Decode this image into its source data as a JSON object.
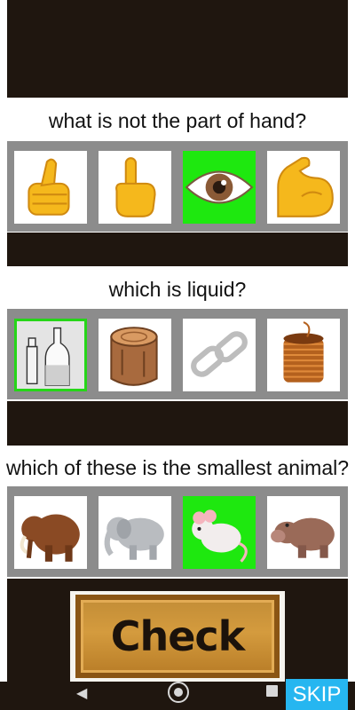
{
  "questions": [
    {
      "prompt": "what is not the part of hand?",
      "options": [
        {
          "name": "thumbs-up",
          "icon": "thumbs-up-icon",
          "selected": false
        },
        {
          "name": "pointing-finger",
          "icon": "pointing-finger-icon",
          "selected": false
        },
        {
          "name": "eye",
          "icon": "eye-icon",
          "selected": true
        },
        {
          "name": "flexed-biceps",
          "icon": "flexed-biceps-icon",
          "selected": false
        }
      ]
    },
    {
      "prompt": "which is liquid?",
      "options": [
        {
          "name": "bottles",
          "icon": "bottles-icon",
          "selected": true
        },
        {
          "name": "wood-log",
          "icon": "wood-log-icon",
          "selected": false
        },
        {
          "name": "chain",
          "icon": "chain-icon",
          "selected": false
        },
        {
          "name": "copper-wire",
          "icon": "copper-wire-icon",
          "selected": false
        }
      ]
    },
    {
      "prompt": "which of these is the smallest animal?",
      "options": [
        {
          "name": "mammoth",
          "icon": "mammoth-icon",
          "selected": false
        },
        {
          "name": "elephant",
          "icon": "elephant-icon",
          "selected": false
        },
        {
          "name": "mouse",
          "icon": "mouse-icon",
          "selected": true
        },
        {
          "name": "hippopotamus",
          "icon": "hippopotamus-icon",
          "selected": false
        }
      ]
    }
  ],
  "check_button": {
    "label": "Check"
  },
  "skip_button": {
    "label": "SKIP"
  },
  "nav": {
    "back": "back-icon",
    "home": "home-icon",
    "recent": "recent-apps-icon"
  },
  "colors": {
    "dark_band": "#1f160f",
    "option_row": "#8c8c8c",
    "selected": "#1ee80f",
    "skip": "#26b6f0"
  }
}
